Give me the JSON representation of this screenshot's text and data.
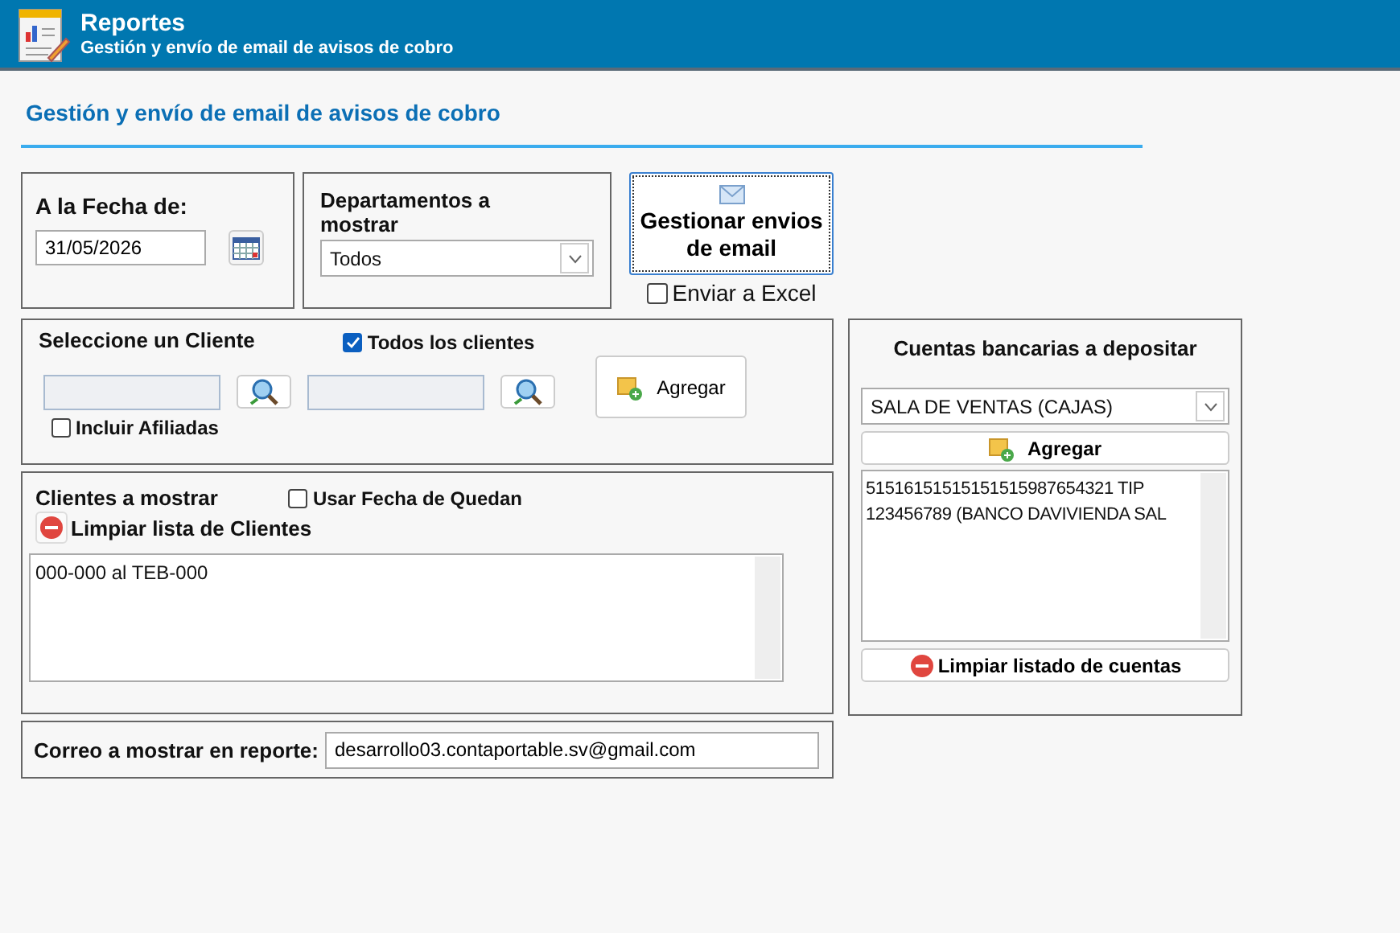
{
  "header": {
    "title": "Reportes",
    "subtitle": "Gestión y envío de email de avisos de cobro"
  },
  "page_title": "Gestión y envío de email de avisos de cobro",
  "fecha": {
    "label": "A la Fecha de:",
    "value": "31/05/2026"
  },
  "departamentos": {
    "label": "Departamentos a mostrar",
    "value": "Todos"
  },
  "gestionar_button": "Gestionar envios de email",
  "enviar_excel": {
    "label": "Enviar a Excel",
    "checked": false
  },
  "cliente": {
    "label": "Seleccione un Cliente",
    "todos": {
      "label": "Todos los clientes",
      "checked": true
    },
    "afiliadas": {
      "label": "Incluir Afiliadas",
      "checked": false
    },
    "agregar": "Agregar"
  },
  "clientes_mostrar": {
    "label": "Clientes  a mostrar",
    "quedan": {
      "label": "Usar Fecha de Quedan",
      "checked": false
    },
    "limpiar": "Limpiar lista de Clientes",
    "items": [
      "000-000 al TEB-000"
    ]
  },
  "correo": {
    "label": "Correo a mostrar en reporte:",
    "value": "desarrollo03.contaportable.sv@gmail.com"
  },
  "cuentas": {
    "title": "Cuentas bancarias a depositar",
    "select": "SALA DE VENTAS (CAJAS)",
    "agregar": "Agregar",
    "items": [
      "51516151515151515987654321 TIP",
      "123456789 (BANCO DAVIVIENDA SAL"
    ],
    "limpiar": "Limpiar listado de cuentas"
  }
}
